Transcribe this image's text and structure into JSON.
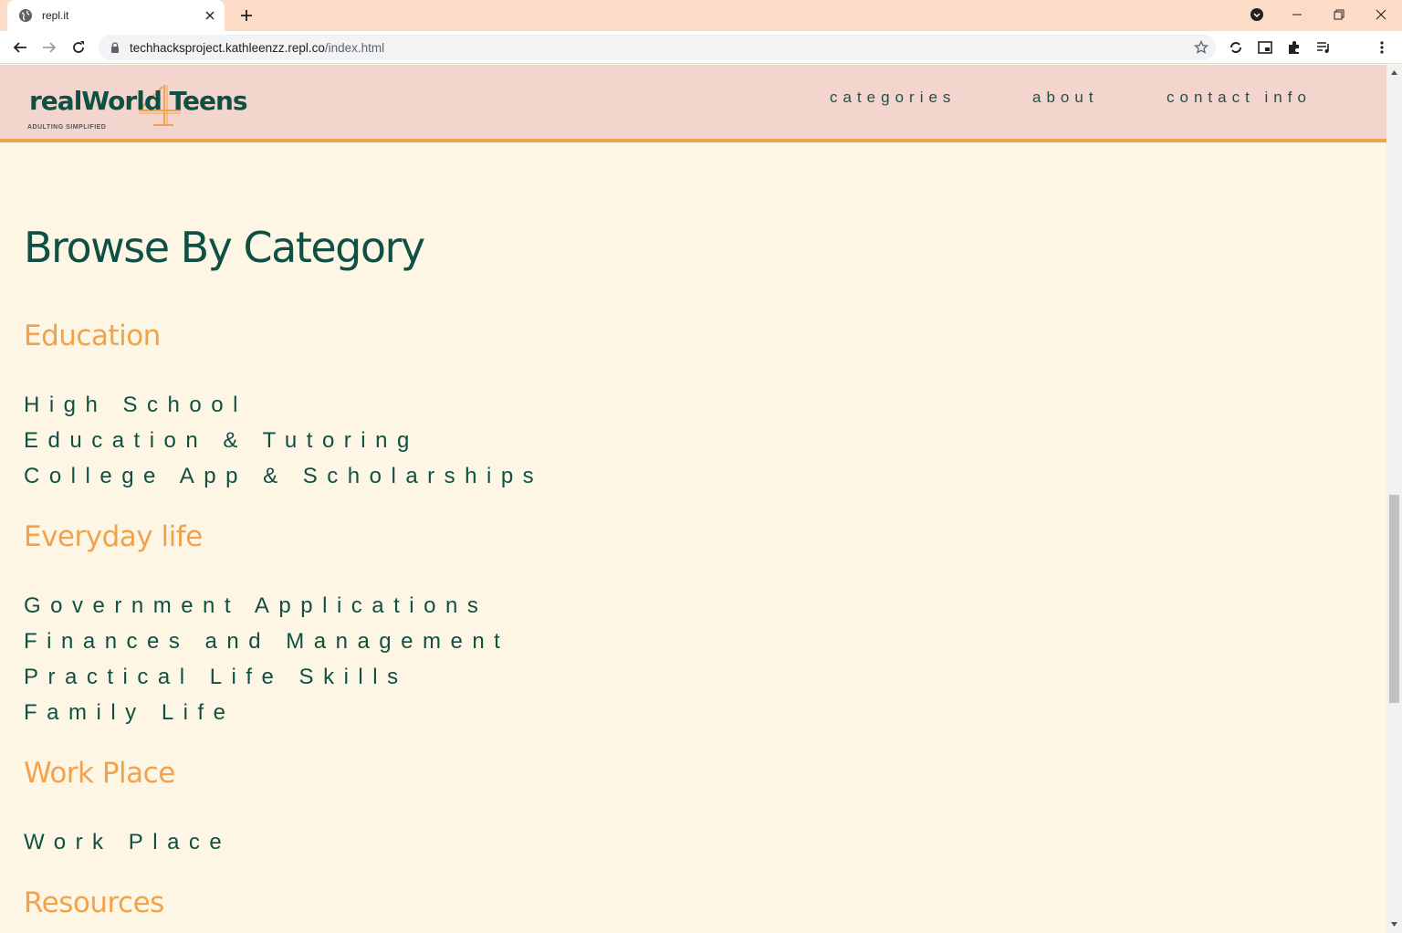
{
  "browser": {
    "tab_title": "repl.it",
    "url_host": "techhacksproject.kathleenzz.repl.co",
    "url_path": "/index.html"
  },
  "site": {
    "logo_text": "realWorld Teens",
    "logo_tagline": "ADULTING SIMPLIFIED",
    "nav": [
      "categories",
      "about",
      "contact info"
    ]
  },
  "main": {
    "title": "Browse By Category",
    "categories": [
      {
        "name": "Education",
        "links": [
          "High School",
          "Education & Tutoring",
          "College App & Scholarships"
        ]
      },
      {
        "name": "Everyday life",
        "links": [
          "Government Applications",
          "Finances and Management",
          "Practical Life Skills",
          "Family Life"
        ]
      },
      {
        "name": "Work Place",
        "links": [
          "Work Place"
        ]
      },
      {
        "name": "Resources",
        "links": []
      }
    ]
  },
  "colors": {
    "tabbar": "#fddcc7",
    "header_bg": "#f3d5ce",
    "header_border": "#f0a24c",
    "page_bg": "#fef6e4",
    "title": "#0f5045",
    "category": "#f0a24c"
  }
}
